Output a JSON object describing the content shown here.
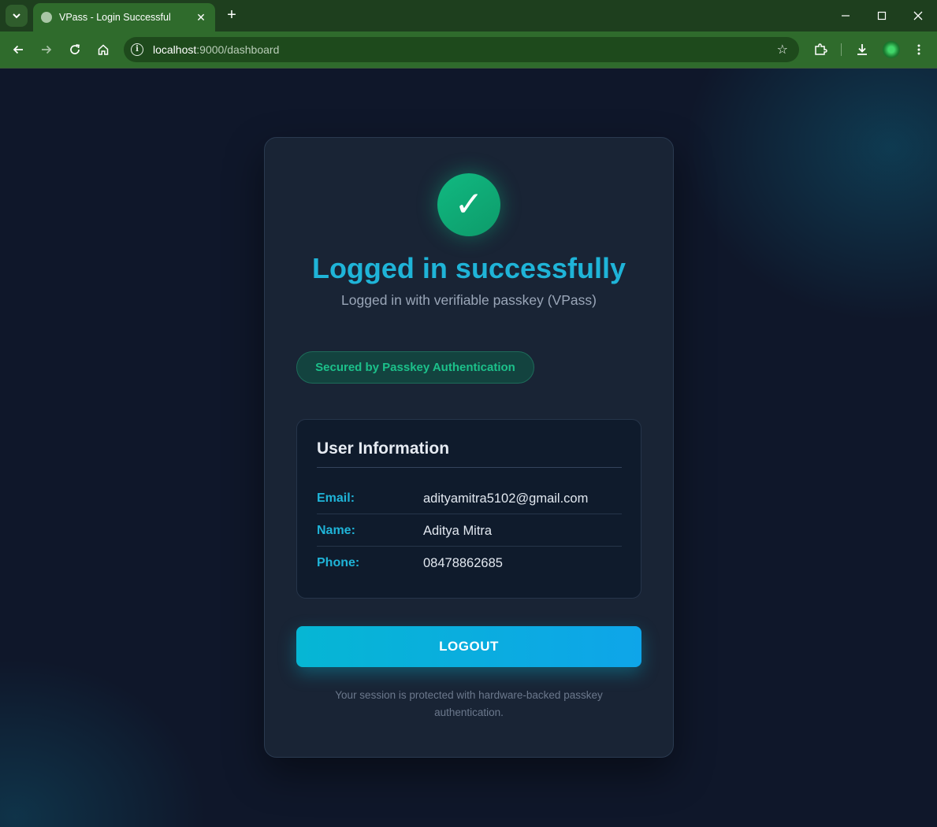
{
  "browser": {
    "tab_title": "VPass - Login Successful",
    "tab_close": "✕",
    "new_tab": "+",
    "url_host": "localhost",
    "url_rest": ":9000/dashboard"
  },
  "hero": {
    "check_glyph": "✓",
    "title": "Logged in successfully",
    "subtitle": "Logged in with verifiable passkey (VPass)"
  },
  "badge": "Secured by Passkey Authentication",
  "user_info": {
    "heading": "User Information",
    "rows": [
      {
        "label": "Email:",
        "value": "adityamitra5102@gmail.com"
      },
      {
        "label": "Name:",
        "value": "Aditya Mitra"
      },
      {
        "label": "Phone:",
        "value": "08478862685"
      }
    ]
  },
  "logout_label": "LOGOUT",
  "footnote": "Your session is protected with hardware-backed passkey authentication.",
  "colors": {
    "accent": "#1fb4d8",
    "success": "#10b981",
    "page_bg": "#0f172a",
    "card_bg": "#192435",
    "browser_frame": "#2f6b2c"
  },
  "icons": [
    "tab-search-icon",
    "globe-icon",
    "close-icon",
    "plus-icon",
    "minimize-icon",
    "maximize-icon",
    "back-icon",
    "forward-icon",
    "reload-icon",
    "home-icon",
    "site-info-icon",
    "star-icon",
    "extensions-icon",
    "download-icon",
    "profile-avatar",
    "menu-icon",
    "check-icon"
  ]
}
